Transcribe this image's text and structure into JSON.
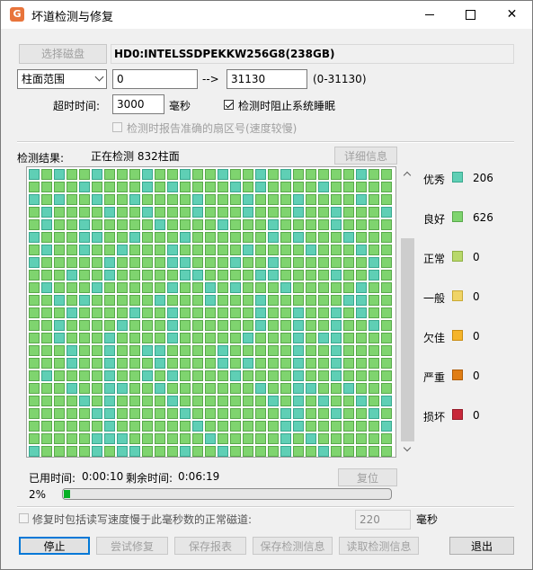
{
  "window": {
    "title": "坏道检测与修复",
    "app_icon_glyph": "G",
    "close_glyph": "✕"
  },
  "disk": {
    "select_button": "选择磁盘",
    "name": "HD0:INTELSSDPEKKW256G8(238GB)"
  },
  "range": {
    "mode": "柱面范围",
    "start": "0",
    "arrow": "-->",
    "end": "31130",
    "hint": "(0-31130)"
  },
  "timeout": {
    "label": "超时时间:",
    "value": "3000",
    "unit": "毫秒"
  },
  "options": {
    "prevent_sleep": "检测时阻止系统睡眠",
    "prevent_sleep_checked": true,
    "report_sectors": "检测时报告准确的扇区号(速度较慢)",
    "report_sectors_checked": false
  },
  "result": {
    "label": "检测结果:",
    "status": "正在检测 832柱面",
    "detail_button": "详细信息"
  },
  "grid": {
    "columns": 29,
    "total_cells": 841,
    "completed": 832,
    "excellent_indices": [
      0,
      5,
      12,
      18,
      33,
      40,
      47,
      58,
      66,
      71,
      79,
      88,
      93,
      104,
      111,
      120,
      126,
      131,
      140,
      149,
      157,
      164,
      170,
      178,
      185,
      191,
      203,
      209,
      214,
      222,
      230,
      235,
      244,
      251,
      259,
      266,
      272,
      281,
      287,
      294,
      300,
      308,
      316,
      322,
      330,
      337,
      343,
      350,
      359,
      366,
      372,
      379,
      388,
      394,
      401,
      409,
      416,
      421,
      430,
      438,
      445,
      452,
      459,
      465,
      473,
      480,
      488,
      496,
      503,
      511,
      518,
      526,
      533,
      541,
      548,
      556,
      563,
      571,
      578,
      586,
      593,
      601,
      608,
      616,
      623,
      631,
      638,
      646,
      653,
      661,
      668,
      676,
      683,
      691,
      698,
      706,
      713,
      721,
      728,
      736,
      743,
      751,
      758,
      766,
      773,
      781,
      788,
      796,
      803,
      811,
      818,
      825,
      20,
      60,
      100,
      150,
      200,
      250,
      300,
      350,
      400,
      450,
      500,
      550,
      600,
      650,
      700,
      750,
      800,
      15,
      45,
      75,
      115,
      145,
      175,
      215,
      245,
      275,
      315,
      345,
      375,
      415,
      445,
      475,
      515,
      545,
      575,
      615,
      645,
      675,
      715,
      745,
      775,
      815,
      2,
      9,
      26,
      38,
      52,
      63,
      84,
      96,
      108,
      117,
      135,
      153,
      166,
      181,
      196,
      219,
      238,
      256,
      262,
      277,
      292,
      304,
      327,
      340,
      355,
      369,
      383,
      398,
      412,
      427,
      441,
      456,
      470,
      485,
      499,
      514,
      528,
      543,
      557,
      572,
      586,
      600,
      614,
      629,
      643,
      658,
      672,
      686,
      701,
      715,
      730,
      744,
      758,
      772,
      786,
      801,
      816,
      830
    ],
    "excellent_color": "#5fcfb5",
    "good_color": "#7fd46f",
    "pending_color": "#f4f4f4"
  },
  "legend": [
    {
      "label": "优秀",
      "count": "206",
      "color": "#5fcfb5",
      "border": "#38a88e"
    },
    {
      "label": "良好",
      "count": "626",
      "color": "#7fd46f",
      "border": "#58a94a"
    },
    {
      "label": "正常",
      "count": "0",
      "color": "#b8d86a",
      "border": "#8fb043"
    },
    {
      "label": "一般",
      "count": "0",
      "color": "#f0d466",
      "border": "#c9a935"
    },
    {
      "label": "欠佳",
      "count": "0",
      "color": "#f5b42a",
      "border": "#c98c10"
    },
    {
      "label": "严重",
      "count": "0",
      "color": "#e07d14",
      "border": "#b05d06"
    },
    {
      "label": "损坏",
      "count": "0",
      "color": "#c8283a",
      "border": "#961a28"
    }
  ],
  "timing": {
    "elapsed_label": "已用时间:",
    "elapsed": "0:00:10",
    "remaining_label": "剩余时间:",
    "remaining": "0:06:19",
    "reset_button": "复位"
  },
  "progress": {
    "text": "2%",
    "fraction": 0.02
  },
  "repair_option": {
    "label": "修复时包括读写速度慢于此毫秒数的正常磁道:",
    "value": "220",
    "unit": "毫秒"
  },
  "actions": {
    "stop": "停止",
    "try_repair": "尝试修复",
    "save_report": "保存报表",
    "save_info": "保存检测信息",
    "load_info": "读取检测信息",
    "exit": "退出"
  }
}
